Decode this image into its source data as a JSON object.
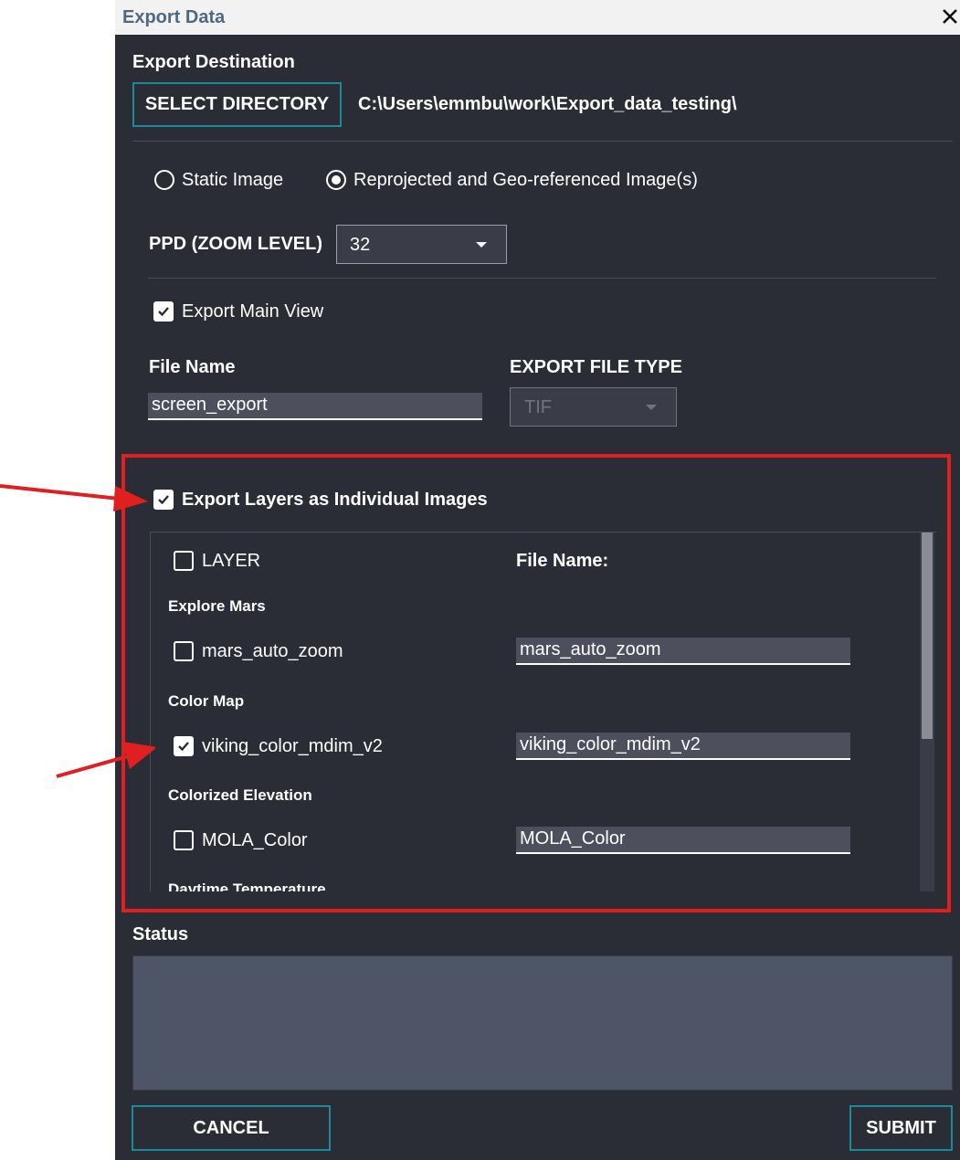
{
  "window": {
    "title": "Export Data"
  },
  "destination": {
    "heading": "Export Destination",
    "select_button": "SELECT DIRECTORY",
    "path": "C:\\Users\\emmbu\\work\\Export_data_testing\\"
  },
  "mode": {
    "options": [
      {
        "label": "Static Image",
        "selected": false
      },
      {
        "label": "Reprojected and Geo-referenced Image(s)",
        "selected": true
      }
    ]
  },
  "ppd": {
    "label": "PPD (ZOOM LEVEL)",
    "value": "32"
  },
  "main_view": {
    "label": "Export Main View",
    "checked": true
  },
  "file_name": {
    "label": "File Name",
    "value": "screen_export"
  },
  "file_type": {
    "label": "EXPORT FILE TYPE",
    "value": "TIF",
    "disabled": true
  },
  "layers": {
    "label": "Export Layers as Individual Images",
    "checked": true,
    "header_label": "LAYER",
    "file_name_header": "File Name:",
    "groups": [
      {
        "name": "Explore Mars",
        "layer": "mars_auto_zoom",
        "checked": false,
        "file_name": "mars_auto_zoom"
      },
      {
        "name": "Color Map",
        "layer": "viking_color_mdim_v2",
        "checked": true,
        "file_name": "viking_color_mdim_v2"
      },
      {
        "name": "Colorized Elevation",
        "layer": "MOLA_Color",
        "checked": false,
        "file_name": "MOLA_Color"
      },
      {
        "name": "Daytime Temperature"
      }
    ]
  },
  "status": {
    "label": "Status",
    "text": ""
  },
  "footer": {
    "cancel": "CANCEL",
    "submit": "SUBMIT"
  },
  "annotation": {
    "highlight_color": "#e02020",
    "arrow_color": "#e02020"
  }
}
